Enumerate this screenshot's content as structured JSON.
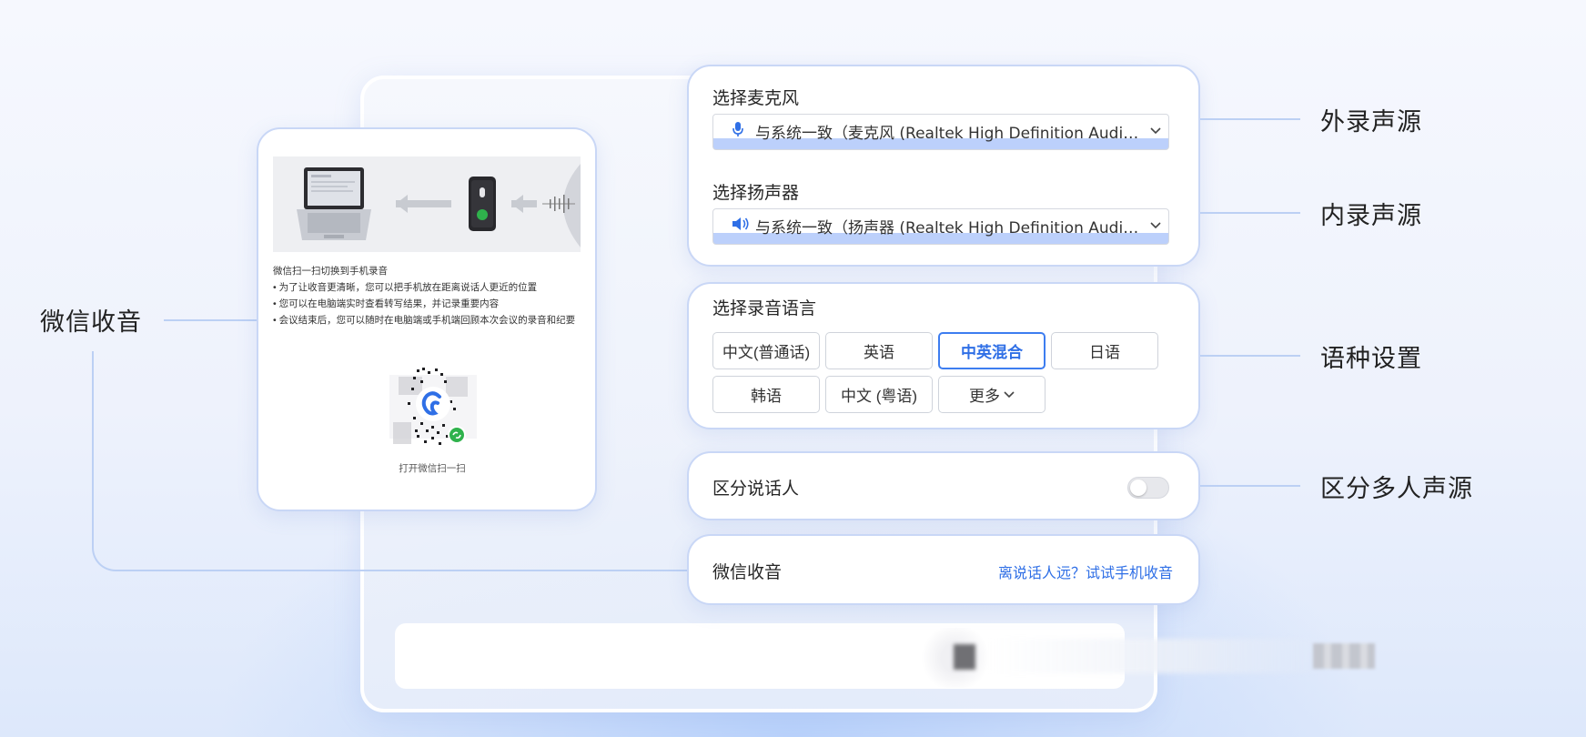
{
  "audio": {
    "mic_label": "选择麦克风",
    "mic_value": "与系统一致（麦克风 (Realtek High Definition Audio)...",
    "speaker_label": "选择扬声器",
    "speaker_value": "与系统一致（扬声器 (Realtek High Definition Audio)..."
  },
  "language": {
    "label": "选择录音语言",
    "options": [
      "中文(普通话)",
      "英语",
      "中英混合",
      "日语",
      "韩语",
      "中文 (粤语)",
      "更多"
    ],
    "selected": "中英混合"
  },
  "speaker_diarization": {
    "label": "区分说话人",
    "enabled": false
  },
  "wechat": {
    "label": "微信收音",
    "link": "离说话人远？试试手机收音"
  },
  "callouts": {
    "external": "外录声源",
    "internal": "内录声源",
    "language": "语种设置",
    "multi_speaker": "区分多人声源",
    "wechat": "微信收音"
  },
  "preview": {
    "title": "微信扫一扫切换到手机录音",
    "bullets": [
      "• 为了让收音更清晰，您可以把手机放在距离说话人更近的位置",
      "• 您可以在电脑端实时查看转写结果，并记录重要内容",
      "• 会议结束后，您可以随时在电脑端或手机端回顾本次会议的录音和纪要"
    ],
    "qr_caption": "打开微信扫一扫"
  },
  "colors": {
    "accent": "#2f6fe6",
    "card_border": "#c9d7f6",
    "connector": "#bcd0f4"
  },
  "icons": {
    "mic": "microphone-icon",
    "speaker": "speaker-icon",
    "chevron": "chevron-down-icon"
  }
}
